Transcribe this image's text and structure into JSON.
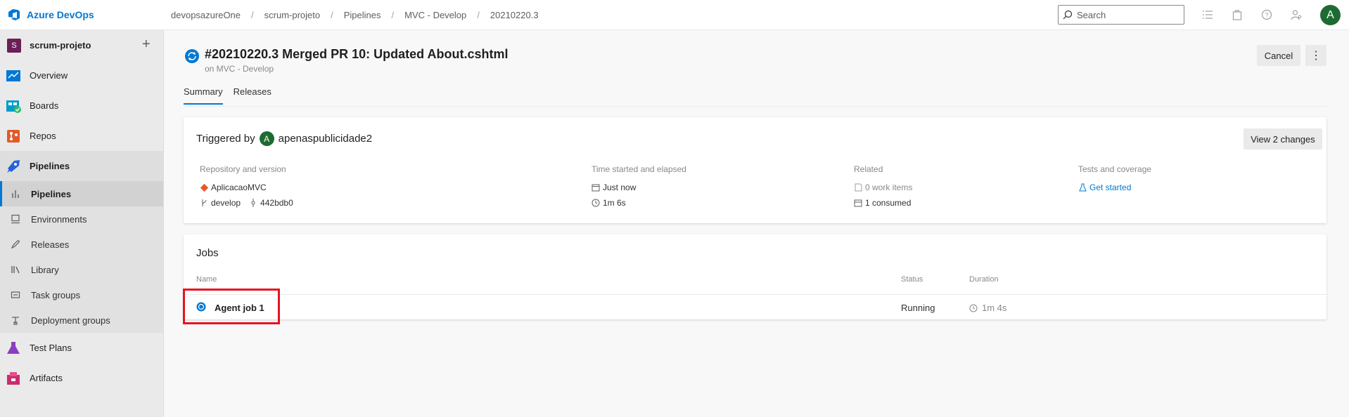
{
  "app": {
    "name": "Azure DevOps"
  },
  "breadcrumb": [
    "devopsazureOne",
    "scrum-projeto",
    "Pipelines",
    "MVC - Develop",
    "20210220.3"
  ],
  "search": {
    "placeholder": "Search"
  },
  "user": {
    "initial": "A"
  },
  "project": {
    "initial": "S",
    "name": "scrum-projeto"
  },
  "nav": {
    "overview": "Overview",
    "boards": "Boards",
    "repos": "Repos",
    "pipelines": "Pipelines",
    "sub": [
      "Pipelines",
      "Environments",
      "Releases",
      "Library",
      "Task groups",
      "Deployment groups"
    ],
    "test_plans": "Test Plans",
    "artifacts": "Artifacts"
  },
  "run": {
    "title": "#20210220.3 Merged PR 10: Updated About.cshtml",
    "subtitle": "on MVC - Develop",
    "cancel": "Cancel",
    "tabs": [
      "Summary",
      "Releases"
    ]
  },
  "trigger": {
    "label": "Triggered by",
    "user_initial": "A",
    "user": "apenaspublicidade2",
    "view_changes": "View 2 changes",
    "repo": {
      "header": "Repository and version",
      "name": "AplicacaoMVC",
      "branch": "develop",
      "commit": "442bdb0"
    },
    "time": {
      "header": "Time started and elapsed",
      "started": "Just now",
      "elapsed": "1m 6s"
    },
    "related": {
      "header": "Related",
      "work_items": "0 work items",
      "consumed": "1 consumed"
    },
    "tests": {
      "header": "Tests and coverage",
      "link": "Get started"
    }
  },
  "jobs": {
    "title": "Jobs",
    "columns": [
      "Name",
      "Status",
      "Duration"
    ],
    "rows": [
      {
        "name": "Agent job 1",
        "status": "Running",
        "duration": "1m 4s"
      }
    ]
  },
  "colors": {
    "accent": "#0078d4",
    "highlight": "#e81123",
    "avatar": "#1e6b32"
  }
}
